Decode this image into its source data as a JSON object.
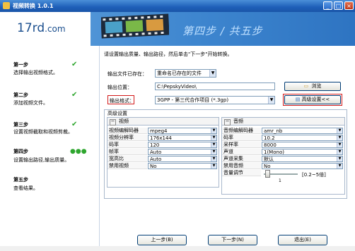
{
  "window": {
    "title": "视频转换 1.0.1",
    "min": "_",
    "max": "□",
    "close": "×"
  },
  "header": {
    "logo_main": "17rd",
    "logo_suffix": ".com",
    "step_title": "第四步 / 共五步"
  },
  "sidebar": {
    "steps": [
      {
        "title": "第一步",
        "desc": "选择输出视频格式。",
        "status": "done"
      },
      {
        "title": "第二步",
        "desc": "添加视频文件。",
        "status": "done"
      },
      {
        "title": "第三步",
        "desc": "设置视频截取和视频剪裁。",
        "status": "done"
      },
      {
        "title": "第四步",
        "desc": "设置输出路径,输出质量。",
        "status": "current"
      },
      {
        "title": "第五步",
        "desc": "查看结果。",
        "status": "pending"
      }
    ],
    "check_glyph": "✔",
    "dots_glyph": "●●●"
  },
  "main": {
    "instruction": "请设置输出质量、输出路径，然后单击\"下一步\"开始转换。",
    "exists_label": "输出文件已存在：",
    "exists_value": "重命名已存在的文件",
    "path_label": "输出位置：",
    "path_value": "C:\\PepskyVideo\\",
    "browse_label": "浏览",
    "format_label": "输出格式：",
    "format_value": "3GPP - 第三代合作项目 (*.3gp)",
    "advanced_button": "高级设置<<",
    "advanced_group_title": "高级设置"
  },
  "video": {
    "header": "视频",
    "rows": [
      {
        "label": "视频编解码器",
        "value": "mpeg4"
      },
      {
        "label": "视频分辨率",
        "value": "176x144"
      },
      {
        "label": "码率",
        "value": "120"
      },
      {
        "label": "帧率",
        "value": "Auto"
      },
      {
        "label": "宽高比",
        "value": "Auto"
      },
      {
        "label": "禁用视频",
        "value": "No"
      }
    ]
  },
  "audio": {
    "header": "音频",
    "rows": [
      {
        "label": "音频编解码器",
        "value": "amr_nb"
      },
      {
        "label": "码率",
        "value": "10.2"
      },
      {
        "label": "采样率",
        "value": "8000"
      },
      {
        "label": "声道",
        "value": "1(Mono)"
      },
      {
        "label": "声道采集",
        "value": "默认"
      },
      {
        "label": "禁用音频",
        "value": "No"
      }
    ],
    "volume_label": "音量调节",
    "volume_value": "1",
    "volume_range": "[0.2~5倍]",
    "volume_fraction": 0.04
  },
  "nav": {
    "prev": "上一步(B)",
    "next": "下一步(N)",
    "exit": "退出(E)"
  }
}
